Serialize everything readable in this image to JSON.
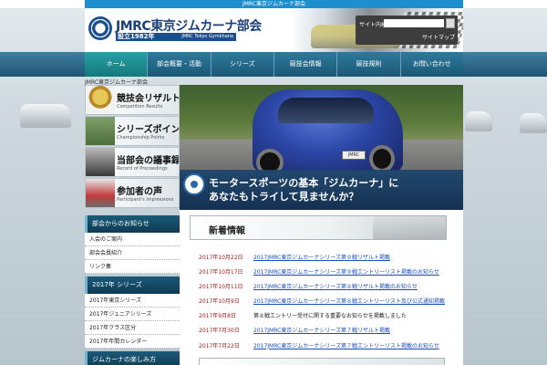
{
  "topbar": {
    "text": "JMRC東京ジムカーナ部会"
  },
  "header": {
    "site_title": "JMRC東京ジムカーナ部会",
    "established": "設立1982年",
    "english_name": "JMRC Tokyo Gymkhana",
    "search_label": "サイト内検索",
    "search_link": "サイトマップ"
  },
  "nav": {
    "items": [
      {
        "label": "ホーム"
      },
      {
        "label": "部会概要・活動"
      },
      {
        "label": "シリーズ"
      },
      {
        "label": "競技会情報"
      },
      {
        "label": "競技規則"
      },
      {
        "label": "お問い合わせ"
      }
    ]
  },
  "breadcrumb": "JMRC東京ジムカーナ部会",
  "promos": [
    {
      "jp": "競技会リザルト",
      "en": "Competition Results"
    },
    {
      "jp": "シリーズポイント",
      "en": "Championship Points"
    },
    {
      "jp": "当部会の議事録",
      "en": "Record of Proceedings"
    },
    {
      "jp": "参加者の声",
      "en": "Participant's Impressions"
    }
  ],
  "sidebar": {
    "section1": {
      "heading": "部会からのお知らせ",
      "links": [
        "入会のご案内",
        "部会会員紹介",
        "リンク集"
      ]
    },
    "section2": {
      "heading": "2017年 シリーズ",
      "links": [
        "2017年東京シリーズ",
        "2017年ジュニアシリーズ",
        "2017年クラス区分",
        "2017年年間カレンダー"
      ]
    },
    "section3": {
      "heading": "ジムカーナの楽しみ方"
    }
  },
  "hero": {
    "line1": "モータースポーツの基本「ジムカーナ」に",
    "line2": "あなたもトライして見ませんか？",
    "badge": "JAF",
    "plate": "JMRC"
  },
  "news": {
    "heading": "新着情報",
    "items": [
      {
        "date": "2017年10月22日",
        "text": "2017JMRC東京ジムカーナシリーズ第９戦リザルト掲載",
        "link": true
      },
      {
        "date": "2017年10月17日",
        "text": "2017JMRC東京ジムカーナシリーズ第９戦エントリーリスト掲載のお知らせ",
        "link": true
      },
      {
        "date": "2017年10月11日",
        "text": "2017JMRC東京ジムカーナシリーズ第８戦リザルト掲載のお知らせ",
        "link": true
      },
      {
        "date": "2017年10月9日",
        "text": "2017JMRC東京ジムカーナシリーズ第８戦エントリーリスト及び公式通知掲載",
        "link": true
      },
      {
        "date": "2017年9月8日",
        "text": "第８戦エントリー受付に関する重要なお知らせを掲載しました",
        "link": false
      },
      {
        "date": "2017年7月30日",
        "text": "2017JMRC東京ジムカーナシリーズ第７戦リザルト掲載",
        "link": true
      },
      {
        "date": "2017年7月22日",
        "text": "2017JMRC東京ジムカーナシリーズ第７戦エントリーリスト掲載のお知らせ",
        "link": true
      }
    ]
  }
}
